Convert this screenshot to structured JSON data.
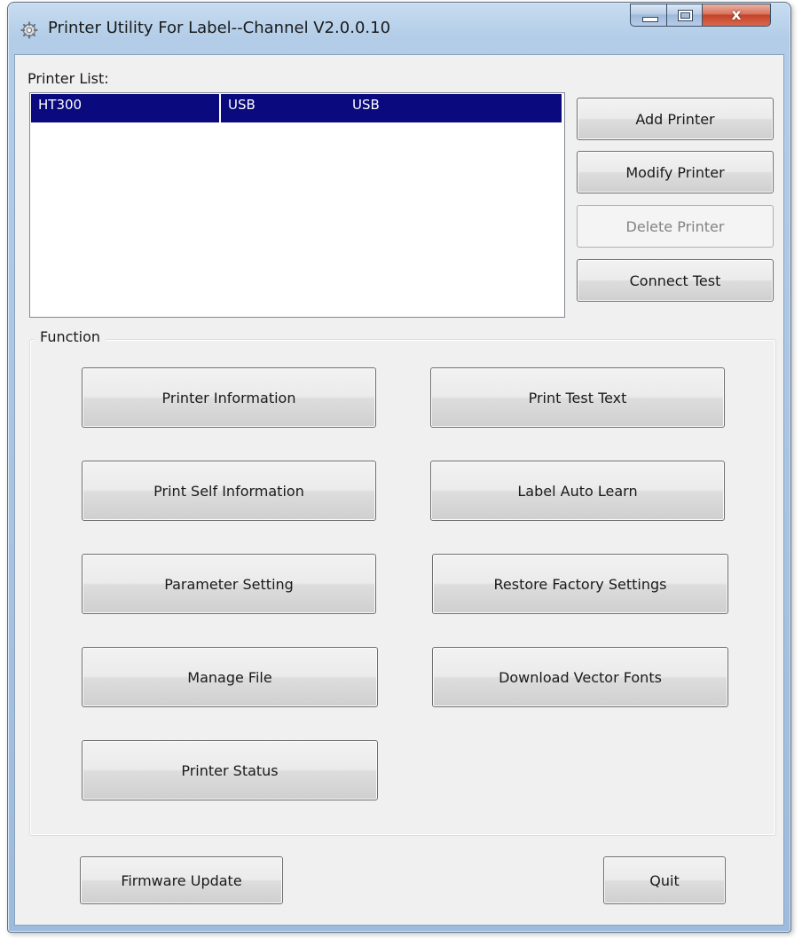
{
  "window": {
    "title": "Printer Utility For Label--Channel  V2.0.0.10",
    "controls": {
      "minimize": "minimize",
      "maximize": "maximize",
      "close": "x"
    }
  },
  "printer_list": {
    "label": "Printer List:",
    "rows": [
      {
        "name": "HT300",
        "port": "USB",
        "interface": "USB",
        "selected": true
      }
    ]
  },
  "printer_buttons": {
    "add": "Add Printer",
    "modify": "Modify Printer",
    "delete": "Delete Printer",
    "connect_test": "Connect Test"
  },
  "function": {
    "label": "Function",
    "buttons": {
      "printer_information": "Printer Information",
      "print_test_text": "Print Test Text",
      "print_self_information": "Print Self Information",
      "label_auto_learn": "Label Auto Learn",
      "parameter_setting": "Parameter Setting",
      "restore_factory_settings": "Restore Factory Settings",
      "manage_file": "Manage File",
      "download_vector_fonts": "Download Vector Fonts",
      "printer_status": "Printer Status"
    }
  },
  "footer": {
    "firmware_update": "Firmware Update",
    "quit": "Quit"
  },
  "colors": {
    "selection": "#0a0a7e",
    "titlebar": "#b3cde8",
    "close_button": "#c4432a"
  },
  "icons": {
    "app": "gear-icon"
  }
}
